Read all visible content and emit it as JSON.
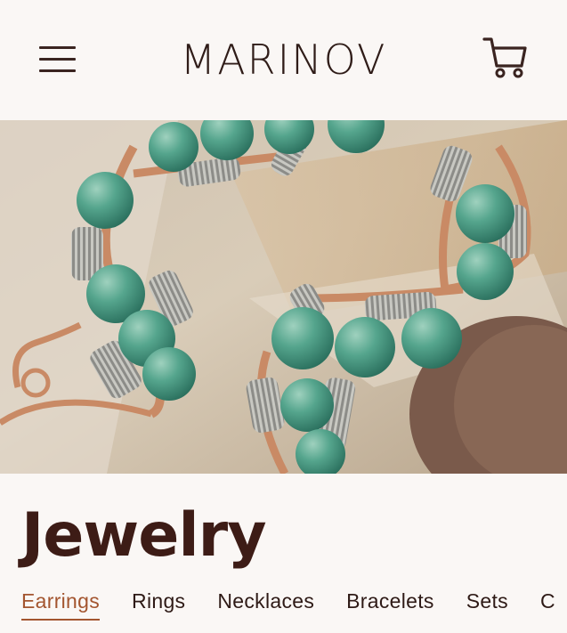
{
  "header": {
    "brand": "MARINOV",
    "menu_icon": "hamburger-menu-icon",
    "cart_icon": "shopping-cart-icon"
  },
  "hero": {
    "alt": "Wire-wrapped copper earrings with green aventurine beads"
  },
  "page": {
    "title": "Jewelry"
  },
  "tabs": [
    {
      "label": "Earrings",
      "active": true
    },
    {
      "label": "Rings"
    },
    {
      "label": "Necklaces"
    },
    {
      "label": "Bracelets"
    },
    {
      "label": "Sets"
    },
    {
      "label": "C"
    }
  ],
  "colors": {
    "background": "#faf7f5",
    "text_dark": "#3d1c16",
    "accent": "#a3552f"
  }
}
